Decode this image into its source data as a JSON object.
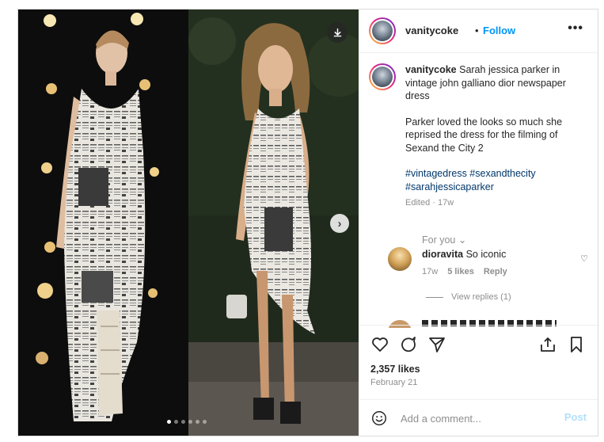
{
  "post": {
    "username": "vanitycoke",
    "follow_label": "Follow",
    "separator": "•",
    "more_label": "•••",
    "caption_line1": "Sarah jessica parker in vintage john galliano dior newspaper dress",
    "caption_line2": "Parker loved the looks so much she reprised the dress for the filming of Sexand the City 2",
    "hashtags": "#vintagedress #sexandthecity #sarahjessicaparker",
    "edited": "Edited · 17w",
    "for_you": "For you",
    "likes": "2,357 likes",
    "date": "February 21"
  },
  "media": {
    "slide_count": 6,
    "active_slide": 1,
    "download_icon": "download-icon",
    "next_icon": "chevron-right-icon"
  },
  "comments": [
    {
      "username": "dioravita",
      "text": "So iconic",
      "age": "17w",
      "likes": "5 likes",
      "reply": "Reply",
      "view_replies": "View replies (1)"
    }
  ],
  "actions": {
    "like_icon": "heart-icon",
    "comment_icon": "comment-icon",
    "share_icon": "share-icon",
    "save_icon": "bookmark-icon",
    "add_icon": "add-to-collection-icon"
  },
  "comment_box": {
    "placeholder": "Add a comment...",
    "post_label": "Post"
  }
}
